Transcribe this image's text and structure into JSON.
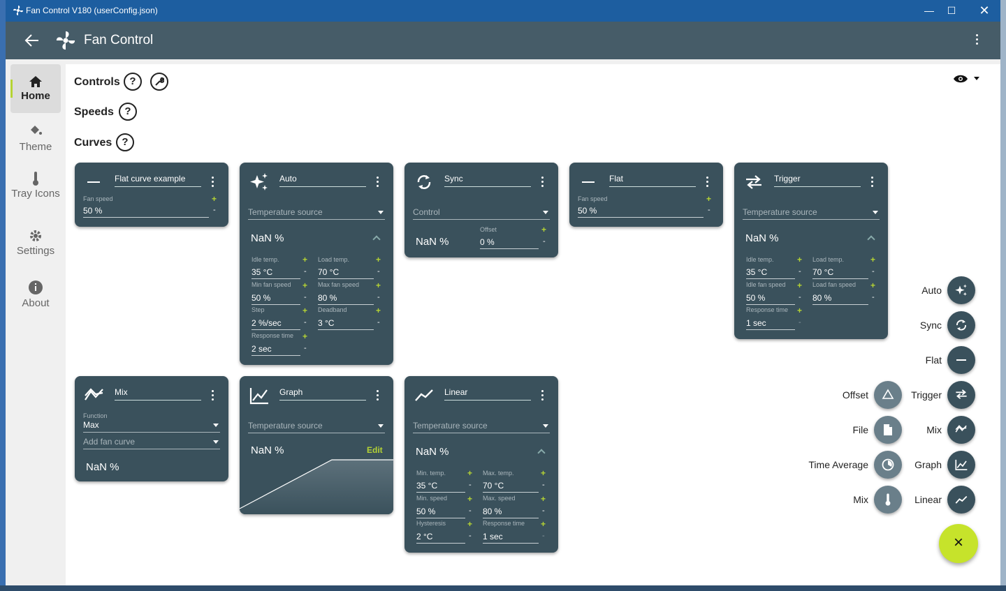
{
  "window": {
    "title": "Fan Control V180 (userConfig.json)"
  },
  "appbar": {
    "title": "Fan Control"
  },
  "nav": [
    {
      "label": "Home",
      "icon": "home-icon"
    },
    {
      "label": "Theme",
      "icon": "paint-bucket-icon"
    },
    {
      "label": "Tray Icons",
      "icon": "thermometer-icon"
    },
    {
      "label": "Settings",
      "icon": "gear-icon"
    },
    {
      "label": "About",
      "icon": "info-icon"
    }
  ],
  "sections": {
    "controls": "Controls",
    "speeds": "Speeds",
    "curves": "Curves",
    "help": "?"
  },
  "cards": {
    "flat_example": {
      "name": "Flat curve example",
      "fan_speed_label": "Fan speed",
      "fan_speed": "50 %"
    },
    "auto": {
      "name": "Auto",
      "source": "Temperature source",
      "nan": "NaN %",
      "idle_temp_label": "Idle temp.",
      "idle_temp": "35 °C",
      "load_temp_label": "Load temp.",
      "load_temp": "70 °C",
      "min_speed_label": "Min fan speed",
      "min_speed": "50 %",
      "max_speed_label": "Max fan speed",
      "max_speed": "80 %",
      "step_label": "Step",
      "step": "2 %/sec",
      "deadband_label": "Deadband",
      "deadband": "3 °C",
      "response_label": "Response time",
      "response": "2 sec"
    },
    "sync": {
      "name": "Sync",
      "source": "Control",
      "nan": "NaN %",
      "offset_label": "Offset",
      "offset": "0 %"
    },
    "flat": {
      "name": "Flat",
      "fan_speed_label": "Fan speed",
      "fan_speed": "50 %"
    },
    "trigger": {
      "name": "Trigger",
      "source": "Temperature source",
      "nan": "NaN %",
      "idle_temp_label": "Idle temp.",
      "idle_temp": "35 °C",
      "load_temp_label": "Load temp.",
      "load_temp": "70 °C",
      "idle_speed_label": "Idle fan speed",
      "idle_speed": "50 %",
      "load_speed_label": "Load fan speed",
      "load_speed": "80 %",
      "response_label": "Response time",
      "response": "1 sec"
    },
    "mix": {
      "name": "Mix",
      "function_label": "Function",
      "function": "Max",
      "add_curve": "Add fan curve",
      "nan": "NaN %"
    },
    "graph": {
      "name": "Graph",
      "source": "Temperature source",
      "nan": "NaN %",
      "edit": "Edit"
    },
    "linear": {
      "name": "Linear",
      "source": "Temperature source",
      "nan": "NaN %",
      "min_temp_label": "Min. temp.",
      "min_temp": "35 °C",
      "max_temp_label": "Max. temp.",
      "max_temp": "70 °C",
      "min_speed_label": "Min. speed",
      "min_speed": "50 %",
      "max_speed_label": "Max. speed",
      "max_speed": "80 %",
      "hyst_label": "Hysteresis",
      "hyst": "2 °C",
      "response_label": "Response time",
      "response": "1 sec"
    }
  },
  "fab": {
    "auto": "Auto",
    "sync": "Sync",
    "flat": "Flat",
    "offset": "Offset",
    "trigger": "Trigger",
    "file": "File",
    "mix": "Mix",
    "time_average": "Time Average",
    "graph": "Graph",
    "mix2": "Mix",
    "linear": "Linear"
  },
  "symbols": {
    "plus": "+",
    "minus": "-",
    "close": "×"
  },
  "colors": {
    "accent": "#c6e32b",
    "card": "#3a515c",
    "appbar": "#465c68",
    "titlebar": "#1d5ea0"
  }
}
